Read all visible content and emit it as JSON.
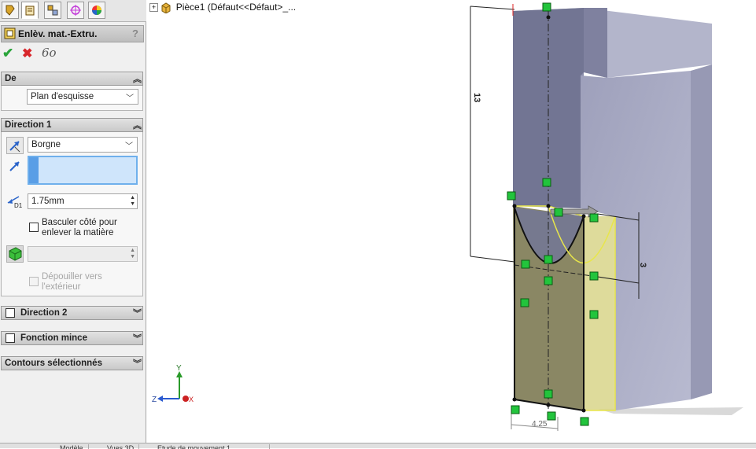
{
  "feature_tree": {
    "part_label": "Pièce1  (Défaut<<Défaut>_..."
  },
  "property_manager": {
    "tabs": [
      "feature-manager-icon",
      "property-manager-icon",
      "configuration-manager-icon",
      "dimxpert-icon",
      "display-manager-icon"
    ],
    "title": "Enlèv. mat.-Extru.",
    "help": "?",
    "actions": {
      "ok": "✔",
      "cancel": "✖",
      "preview": "6o"
    },
    "from": {
      "header": "De",
      "value": "Plan d'esquisse"
    },
    "direction1": {
      "header": "Direction 1",
      "end_condition": "Borgne",
      "depth": "1.75mm",
      "flip_side_label_1": "Basculer côté pour",
      "flip_side_label_2": "enlever la matière",
      "draft_label_1": "Dépouiller vers",
      "draft_label_2": "l'extérieur",
      "depth_icon_label": "D1"
    },
    "direction2": {
      "header": "Direction 2"
    },
    "thin_feature": {
      "header": "Fonction mince"
    },
    "selected_contours": {
      "header": "Contours sélectionnés"
    }
  },
  "dimensions": {
    "height": "13",
    "right": "3",
    "bottom": "4.25"
  },
  "triad": {
    "y": "Y",
    "z": "Z",
    "x": "X"
  },
  "bottom_tabs": [
    "Modèle",
    "Vues 3D",
    "Etude de mouvement 1"
  ],
  "colors": {
    "part_face_dark": "#7a7c97",
    "part_face_light": "#a9abc3",
    "part_top": "#b5b7cc",
    "sketch_yellow": "#f2f07a",
    "preview_fill": "#7d7a4f",
    "relation_green": "#1cc43a",
    "accent_blue": "#3a7dd8"
  }
}
